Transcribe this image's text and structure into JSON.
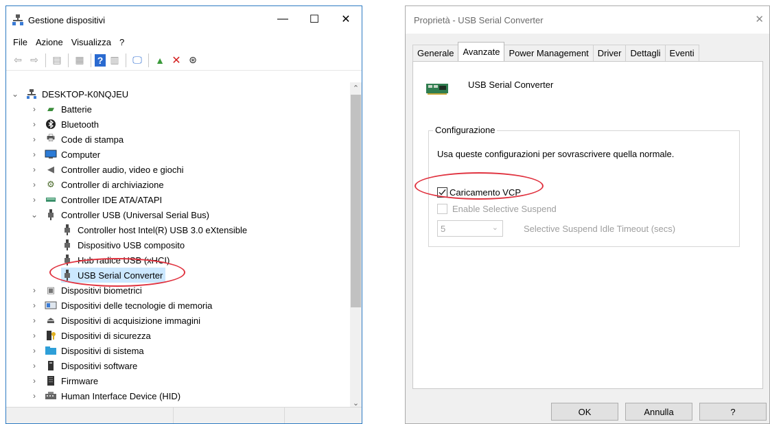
{
  "device_manager": {
    "title": "Gestione dispositivi",
    "window_buttons": {
      "minimize": "—",
      "maximize": "☐",
      "close": "✕"
    },
    "menu": [
      "File",
      "Azione",
      "Visualizza",
      "?"
    ],
    "toolbar": [
      {
        "icon": "back-arrow-icon",
        "glyph": "⇦"
      },
      {
        "icon": "forward-arrow-icon",
        "glyph": "⇨"
      },
      {
        "icon": "properties-window-icon",
        "glyph": "▤"
      },
      {
        "icon": "update-window-icon",
        "glyph": "▦"
      },
      {
        "icon": "help-book-icon",
        "glyph": "?"
      },
      {
        "icon": "list-view-icon",
        "glyph": "▥"
      },
      {
        "icon": "monitor-scan-icon",
        "glyph": "🖵"
      },
      {
        "icon": "add-driver-icon",
        "glyph": "▲"
      },
      {
        "icon": "uninstall-icon",
        "glyph": "✕"
      },
      {
        "icon": "download-icon",
        "glyph": "⊛"
      }
    ],
    "tree": {
      "root": "DESKTOP-K0NQJEU",
      "categories": [
        {
          "label": "Batterie",
          "icon": "battery-icon"
        },
        {
          "label": "Bluetooth",
          "icon": "bluetooth-icon"
        },
        {
          "label": "Code di stampa",
          "icon": "printer-icon"
        },
        {
          "label": "Computer",
          "icon": "computer-icon"
        },
        {
          "label": "Controller audio, video e giochi",
          "icon": "speaker-icon"
        },
        {
          "label": "Controller di archiviazione",
          "icon": "storage-icon"
        },
        {
          "label": "Controller IDE ATA/ATAPI",
          "icon": "ide-icon"
        },
        {
          "label": "Controller USB (Universal Serial Bus)",
          "icon": "usb-icon",
          "expanded": true
        }
      ],
      "usb_children": [
        "Controller host Intel(R) USB 3.0 eXtensible",
        "Dispositivo USB composito",
        "Hub radice USB (xHCI)",
        "USB Serial Converter"
      ],
      "after_categories": [
        {
          "label": "Dispositivi biometrici",
          "icon": "fingerprint-icon"
        },
        {
          "label": "Dispositivi delle tecnologie di memoria",
          "icon": "memory-card-icon"
        },
        {
          "label": "Dispositivi di acquisizione immagini",
          "icon": "scanner-icon"
        },
        {
          "label": "Dispositivi di sicurezza",
          "icon": "security-device-icon"
        },
        {
          "label": "Dispositivi di sistema",
          "icon": "system-folder-icon"
        },
        {
          "label": "Dispositivi software",
          "icon": "software-device-icon"
        },
        {
          "label": "Firmware",
          "icon": "firmware-icon"
        },
        {
          "label": "Human Interface Device (HID)",
          "icon": "hid-icon"
        }
      ],
      "selected": "USB Serial Converter"
    }
  },
  "properties": {
    "title": "Proprietà - USB Serial Converter",
    "close_glyph": "✕",
    "tabs": [
      "Generale",
      "Avanzate",
      "Power Management",
      "Driver",
      "Dettagli",
      "Eventi"
    ],
    "active_tab": "Avanzate",
    "device_name": "USB Serial Converter",
    "group_title": "Configurazione",
    "group_description": "Usa queste configurazioni per sovrascrivere quella normale.",
    "vcp_label": "Caricamento VCP",
    "vcp_checked": true,
    "selective_suspend_label": "Enable Selective Suspend",
    "selective_suspend_checked": false,
    "timeout_value": "5",
    "timeout_label": "Selective Suspend Idle Timeout (secs)",
    "buttons": {
      "ok": "OK",
      "cancel": "Annulla",
      "help": "?"
    }
  },
  "colors": {
    "selection": "#cce8ff",
    "annotation": "#e0323f",
    "window_border": "#2b79c2"
  }
}
